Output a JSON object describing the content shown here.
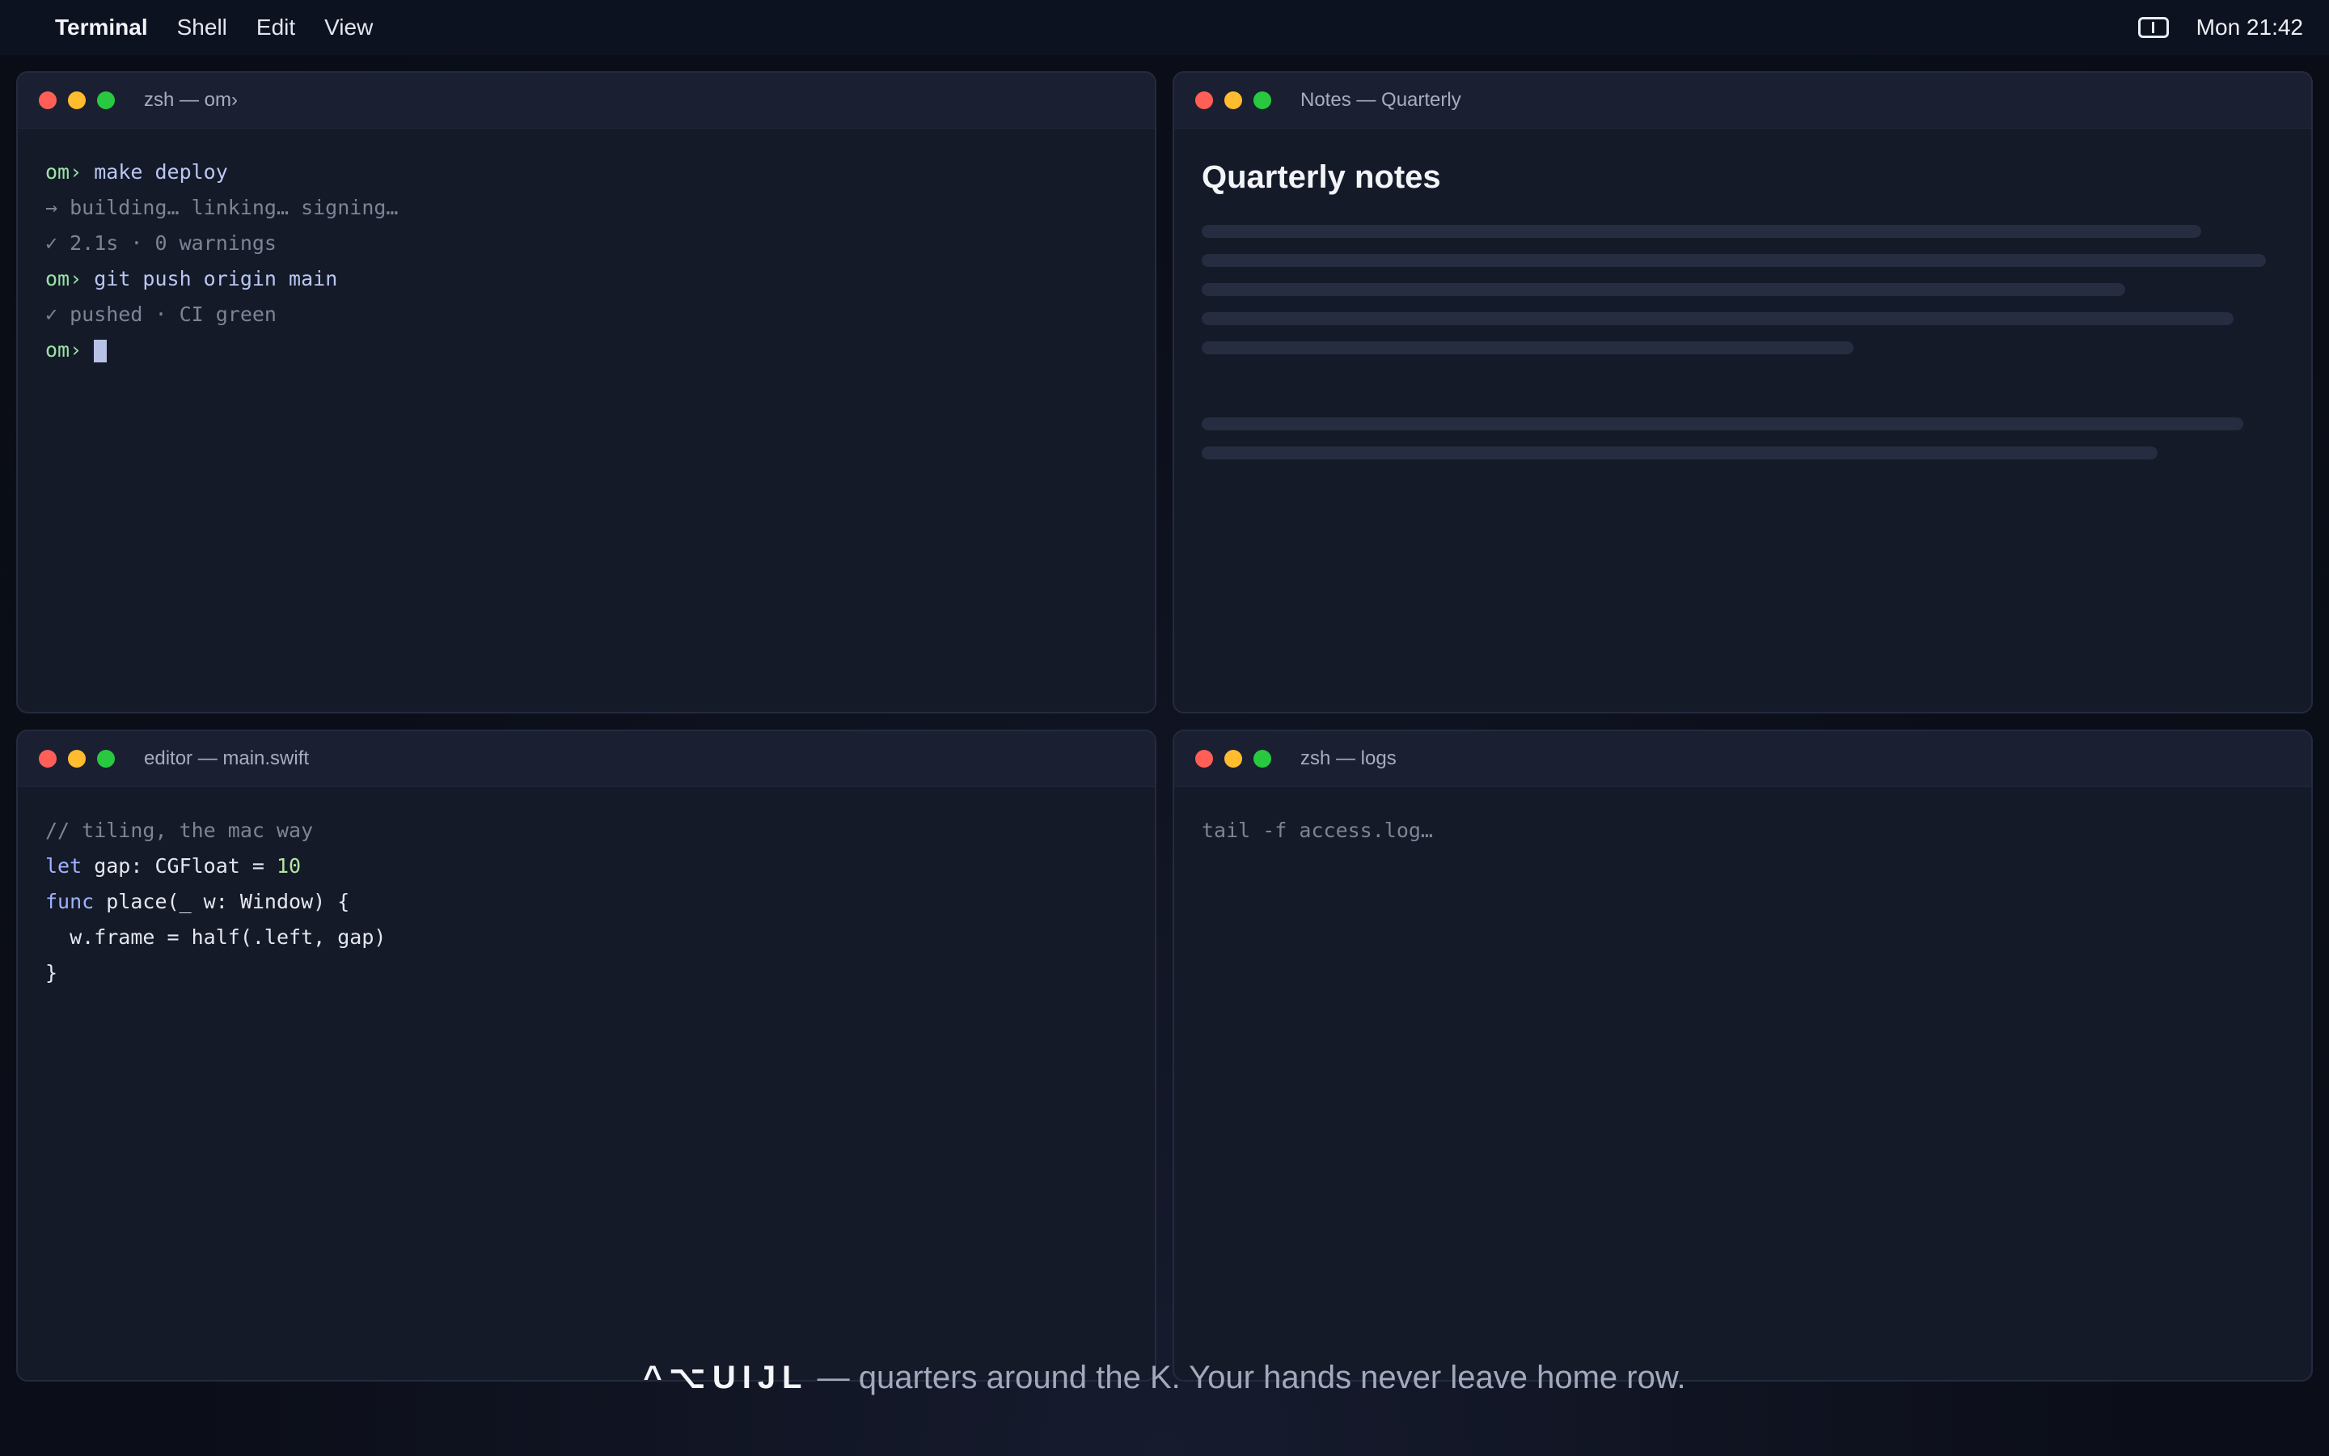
{
  "menubar": {
    "app": "Terminal",
    "menus": [
      "Shell",
      "Edit",
      "View"
    ],
    "clock": "Mon 21:42"
  },
  "windows": {
    "terminal": {
      "title": "zsh — om›",
      "lines": [
        {
          "prompt": "om›",
          "text": "make deploy"
        },
        {
          "text": "→ building… linking… signing…"
        },
        {
          "text": "✓ 2.1s · 0 warnings"
        },
        {
          "prompt": "om›",
          "text": "git push origin main"
        },
        {
          "text": "✓ pushed · CI green"
        },
        {
          "prompt": "om›",
          "text": ""
        }
      ]
    },
    "notes": {
      "title": "Notes — Quarterly",
      "heading": "Quarterly notes"
    },
    "editor": {
      "title": "editor — main.swift",
      "code": {
        "comment": "// tiling, the mac way",
        "let_kw": "let",
        "let_rest": " gap: CGFloat = ",
        "let_num": "10",
        "func_kw": "func",
        "func_rest": " place(_ w: Window) {",
        "body": "  w.frame = half(.left, gap)",
        "close": "}"
      }
    },
    "logs": {
      "title": "zsh — logs",
      "text": "tail -f access.log…"
    }
  },
  "caption": {
    "keys": "^⌥UIJL",
    "text": " — quarters around the K. Your hands never leave home row."
  }
}
